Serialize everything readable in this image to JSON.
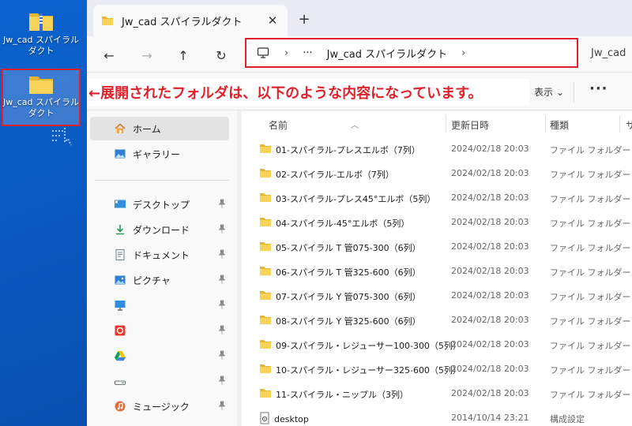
{
  "desktop": {
    "icon1_label": "Jw_cad スパイラルダクト",
    "icon2_label": "Jw_cad スパイラルダクト"
  },
  "window": {
    "tab_title": "Jw_cad スパイラルダクト",
    "tab_close": "✕",
    "new_tab": "+",
    "nav": {
      "back": "←",
      "forward": "→",
      "up": "↑",
      "refresh": "↻"
    },
    "address": {
      "sep1": "›",
      "ellipsis": "···",
      "folder": "Jw_cad スパイラルダクト",
      "sep2": "›"
    },
    "search_fragment": "Jw_cad",
    "annotation": "←展開されたフォルダは、以下のような内容になっています。",
    "display_label": "表示 ⌄",
    "more_label": "···"
  },
  "sidebar": {
    "items": [
      {
        "label": "ホーム",
        "icon": "home-icon"
      },
      {
        "label": "ギャラリー",
        "icon": "gallery-icon"
      },
      {
        "label": "デスクトップ",
        "icon": "desktop-icon"
      },
      {
        "label": "ダウンロード",
        "icon": "download-icon"
      },
      {
        "label": "ドキュメント",
        "icon": "document-icon"
      },
      {
        "label": "ピクチャ",
        "icon": "pictures-icon"
      },
      {
        "label": "",
        "icon": "monitor-icon"
      },
      {
        "label": "",
        "icon": "red-app-icon"
      },
      {
        "label": "",
        "icon": "drive-icon"
      },
      {
        "label": "",
        "icon": "disk-icon"
      },
      {
        "label": "ミュージック",
        "icon": "music-icon"
      }
    ]
  },
  "columns": {
    "name": "名前",
    "modified": "更新日時",
    "type": "種類",
    "size": "サ"
  },
  "files": [
    {
      "name": "01-スパイラル-プレスエルボ（7列）",
      "date": "2024/02/18 20:03",
      "type": "ファイル フォルダー",
      "kind": "folder"
    },
    {
      "name": "02-スパイラル-エルボ（7列）",
      "date": "2024/02/18 20:03",
      "type": "ファイル フォルダー",
      "kind": "folder"
    },
    {
      "name": "03-スパイラル-プレス45°エルボ（5列）",
      "date": "2024/02/18 20:03",
      "type": "ファイル フォルダー",
      "kind": "folder"
    },
    {
      "name": "04-スパイラル-45°エルボ（5列）",
      "date": "2024/02/18 20:03",
      "type": "ファイル フォルダー",
      "kind": "folder"
    },
    {
      "name": "05-スパイラル T 管075-300（6列）",
      "date": "2024/02/18 20:03",
      "type": "ファイル フォルダー",
      "kind": "folder"
    },
    {
      "name": "06-スパイラル T 管325-600（6列）",
      "date": "2024/02/18 20:03",
      "type": "ファイル フォルダー",
      "kind": "folder"
    },
    {
      "name": "07-スパイラル Y 管075-300（6列）",
      "date": "2024/02/18 20:03",
      "type": "ファイル フォルダー",
      "kind": "folder"
    },
    {
      "name": "08-スパイラル Y 管325-600（6列）",
      "date": "2024/02/18 20:03",
      "type": "ファイル フォルダー",
      "kind": "folder"
    },
    {
      "name": "09-スパイラル・レジューサー100-300（5列）",
      "date": "2024/02/18 20:03",
      "type": "ファイル フォルダー",
      "kind": "folder"
    },
    {
      "name": "10-スパイラル・レジューサー325-600（5列）",
      "date": "2024/02/18 20:03",
      "type": "ファイル フォルダー",
      "kind": "folder"
    },
    {
      "name": "11-スパイラル・ニップル（3列）",
      "date": "2024/02/18 20:03",
      "type": "ファイル フォルダー",
      "kind": "folder"
    },
    {
      "name": "desktop",
      "date": "2014/10/14 23:21",
      "type": "構成設定",
      "kind": "ini"
    }
  ],
  "colors": {
    "annotation_red": "#e0202a",
    "folder_yellow": "#f4c53d",
    "desktop_blue": "#0a5fc4"
  }
}
